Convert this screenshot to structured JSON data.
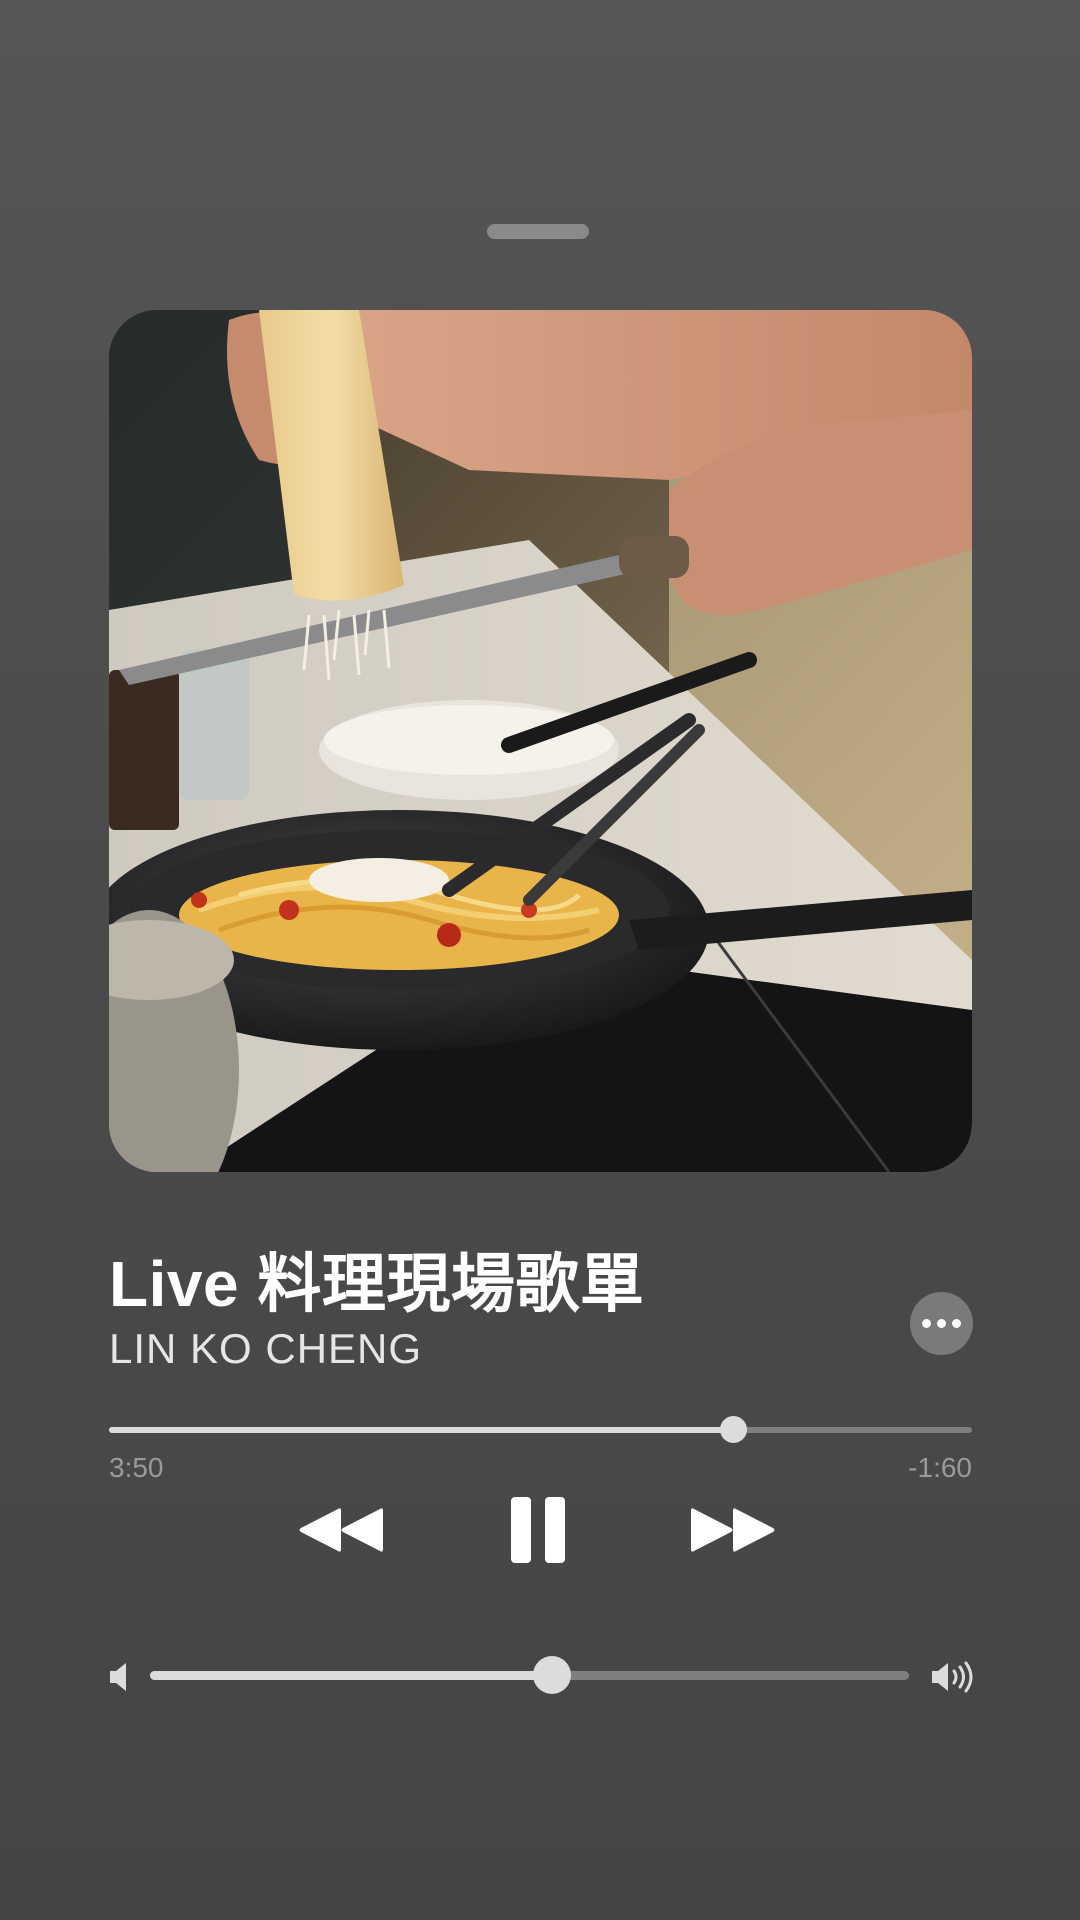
{
  "now_playing": {
    "title": "Live 料理現場歌單",
    "artist": "LIN KO CHENG",
    "artwork": "cooking-pasta-photo"
  },
  "playback": {
    "elapsed": "3:50",
    "remaining": "-1:60",
    "progress_fraction": 0.723,
    "state": "playing"
  },
  "controls": {
    "rewind_icon": "rewind-icon",
    "pause_icon": "pause-icon",
    "forward_icon": "fast-forward-icon",
    "more_icon": "ellipsis-icon"
  },
  "volume": {
    "level_fraction": 0.53,
    "low_icon": "speaker-low-icon",
    "high_icon": "speaker-high-icon"
  },
  "colors": {
    "background": "#4b4b4b",
    "track_active": "#dcdcdc",
    "track_inactive": "#7f7f7f",
    "time_text": "#9a9a9a"
  }
}
